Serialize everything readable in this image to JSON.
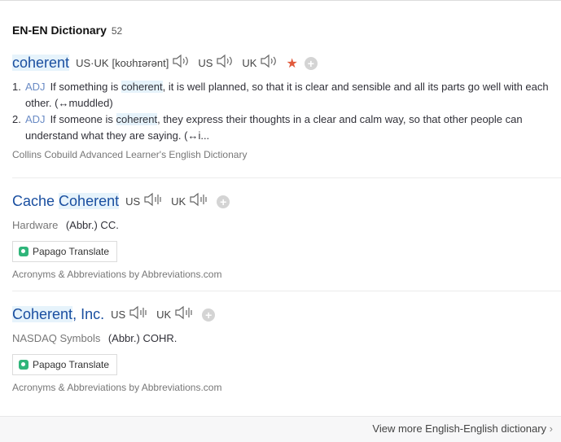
{
  "section": {
    "title": "EN-EN Dictionary",
    "count": "52"
  },
  "entry1": {
    "headword": "coherent",
    "us_uk_label": "US·UK",
    "phonetic": "[koʊhɪərənt]",
    "us_label": "US",
    "uk_label": "UK",
    "senses": [
      {
        "num": "1.",
        "pos": "ADJ",
        "pre": "If something is ",
        "hl": "coherent",
        "post": ", it is well planned, so that it is clear and sensible and all its parts go well with each other. (↔muddled)"
      },
      {
        "num": "2.",
        "pos": "ADJ",
        "pre": "If someone is ",
        "hl": "coherent",
        "post": ", they express their thoughts in a clear and calm way, so that other people can understand what they are saying. (↔i..."
      }
    ],
    "source": "Collins Cobuild Advanced Learner's English Dictionary"
  },
  "entry2": {
    "head_pre": "Cache ",
    "head_hl": "Coherent",
    "us_label": "US",
    "uk_label": "UK",
    "tag": "Hardware",
    "abbr": "(Abbr.) CC.",
    "papago": "Papago Translate",
    "source": "Acronyms & Abbreviations by Abbreviations.com"
  },
  "entry3": {
    "head_hl": "Coherent",
    "head_post": ", Inc.",
    "us_label": "US",
    "uk_label": "UK",
    "tag": "NASDAQ Symbols",
    "abbr": "(Abbr.) COHR.",
    "papago": "Papago Translate",
    "source": "Acronyms & Abbreviations by Abbreviations.com"
  },
  "footer": {
    "more_label": "View more English-English dictionary"
  },
  "icons": [
    "speaker-icon",
    "star-icon",
    "plus-icon",
    "papago-icon",
    "chevron-right-icon"
  ],
  "colors": {
    "headword": "#1a4fa0",
    "highlight_bg": "#e6f3fb",
    "star": "#e15a3c",
    "pos": "#6a8bc5"
  }
}
